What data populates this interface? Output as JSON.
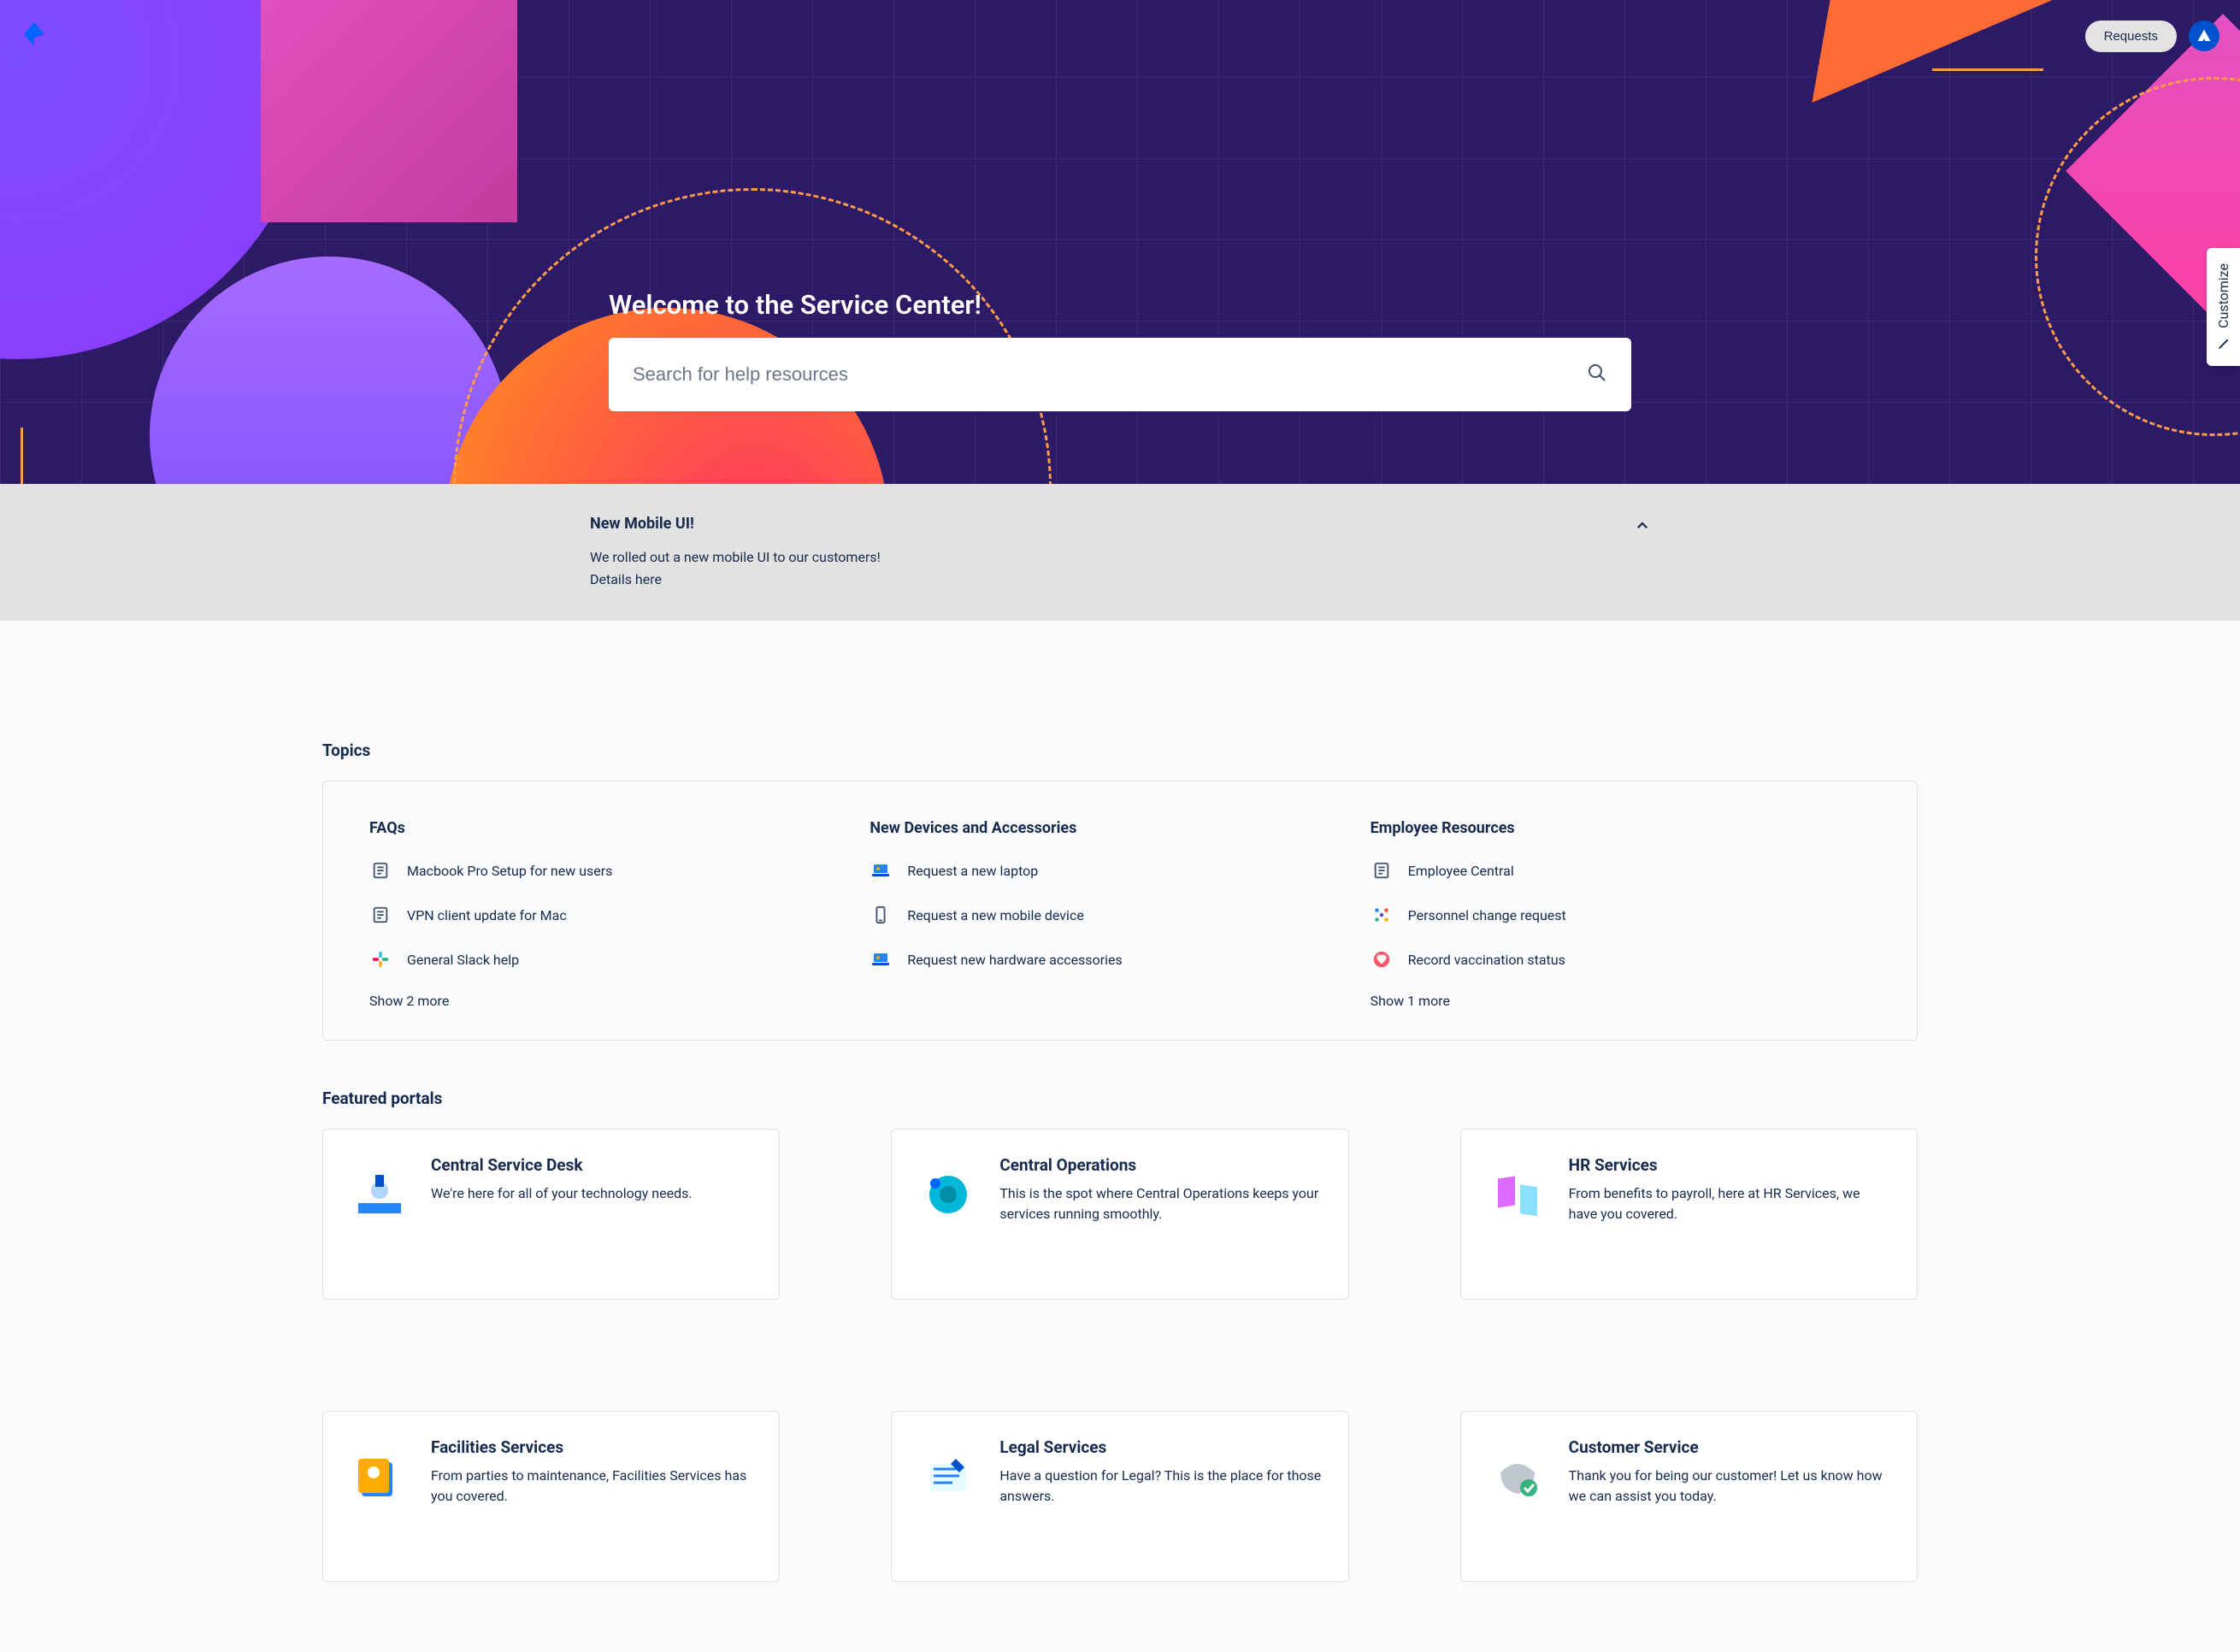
{
  "topbar": {
    "requests_label": "Requests"
  },
  "hero": {
    "title": "Welcome to the Service Center!",
    "search_placeholder": "Search for help resources"
  },
  "customize": {
    "label": "Customize"
  },
  "announcement": {
    "title": "New Mobile UI!",
    "line1": "We rolled out a new mobile UI to our customers!",
    "line2": "Details here"
  },
  "topics": {
    "section_title": "Topics",
    "columns": [
      {
        "title": "FAQs",
        "items": [
          {
            "label": "Macbook Pro Setup for new users",
            "icon": "doc"
          },
          {
            "label": "VPN client update for Mac",
            "icon": "doc"
          },
          {
            "label": "General Slack help",
            "icon": "slack"
          }
        ],
        "show_more": "Show 2 more"
      },
      {
        "title": "New Devices and Accessories",
        "items": [
          {
            "label": "Request a new laptop",
            "icon": "laptop"
          },
          {
            "label": "Request a new mobile device",
            "icon": "phone"
          },
          {
            "label": "Request new hardware accessories",
            "icon": "laptop"
          }
        ],
        "show_more": ""
      },
      {
        "title": "Employee Resources",
        "items": [
          {
            "label": "Employee Central",
            "icon": "doc"
          },
          {
            "label": "Personnel change request",
            "icon": "dots"
          },
          {
            "label": "Record vaccination status",
            "icon": "heart"
          }
        ],
        "show_more": "Show 1 more"
      }
    ]
  },
  "portals": {
    "section_title": "Featured portals",
    "cards": [
      {
        "name": "Central Service Desk",
        "desc": "We're here for all of your technology needs."
      },
      {
        "name": "Central Operations",
        "desc": "This is the spot where Central Operations keeps your services running smoothly."
      },
      {
        "name": "HR Services",
        "desc": "From benefits to payroll, here at HR Services, we have you covered."
      },
      {
        "name": "Facilities Services",
        "desc": "From parties to maintenance, Facilities Services has you covered."
      },
      {
        "name": "Legal Services",
        "desc": "Have a question for Legal? This is the place for those answers."
      },
      {
        "name": "Customer Service",
        "desc": "Thank you for being our customer! Let us know how we can assist you today."
      }
    ]
  }
}
